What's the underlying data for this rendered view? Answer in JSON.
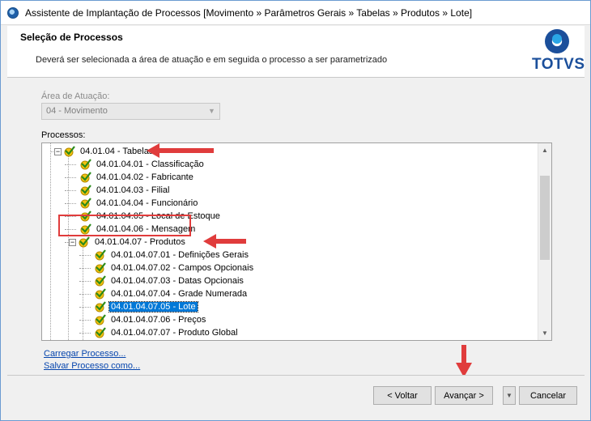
{
  "window": {
    "title": "Assistente de Implantação de Processos [Movimento » Parâmetros Gerais » Tabelas » Produtos » Lote]"
  },
  "header": {
    "title": "Seleção de Processos",
    "description": "Deverá ser selecionada a área de atuação e em seguida o processo a ser parametrizado",
    "logo": "TOTVS"
  },
  "area": {
    "label": "Área de Atuação:",
    "value": "04 - Movimento"
  },
  "processes": {
    "label": "Processos:",
    "items": [
      {
        "label": "04.01.04 - Tabelas",
        "level": 0,
        "expander": "−"
      },
      {
        "label": "04.01.04.01 - Classificação",
        "level": 1
      },
      {
        "label": "04.01.04.02 - Fabricante",
        "level": 1
      },
      {
        "label": "04.01.04.03 - Filial",
        "level": 1
      },
      {
        "label": "04.01.04.04 - Funcionário",
        "level": 1
      },
      {
        "label": "04.01.04.05 - Local de Estoque",
        "level": 1
      },
      {
        "label": "04.01.04.06 - Mensagem",
        "level": 1
      },
      {
        "label": "04.01.04.07 - Produtos",
        "level": 1,
        "expander": "−"
      },
      {
        "label": "04.01.04.07.01 - Definições Gerais",
        "level": 2
      },
      {
        "label": "04.01.04.07.02 - Campos Opcionais",
        "level": 2
      },
      {
        "label": "04.01.04.07.03 - Datas Opcionais",
        "level": 2
      },
      {
        "label": "04.01.04.07.04 - Grade Numerada",
        "level": 2
      },
      {
        "label": "04.01.04.07.05 - Lote",
        "level": 2,
        "selected": true
      },
      {
        "label": "04.01.04.07.06 - Preços",
        "level": 2
      },
      {
        "label": "04.01.04.07.07 - Produto Global",
        "level": 2
      }
    ]
  },
  "links": {
    "load": "Carregar Processo...",
    "save": "Salvar Processo como..."
  },
  "buttons": {
    "back": "< Voltar",
    "next": "Avançar >",
    "cancel": "Cancelar"
  },
  "colors": {
    "selection": "#0078d7",
    "annotation": "#e03c3c",
    "brand": "#1b4f9b"
  }
}
